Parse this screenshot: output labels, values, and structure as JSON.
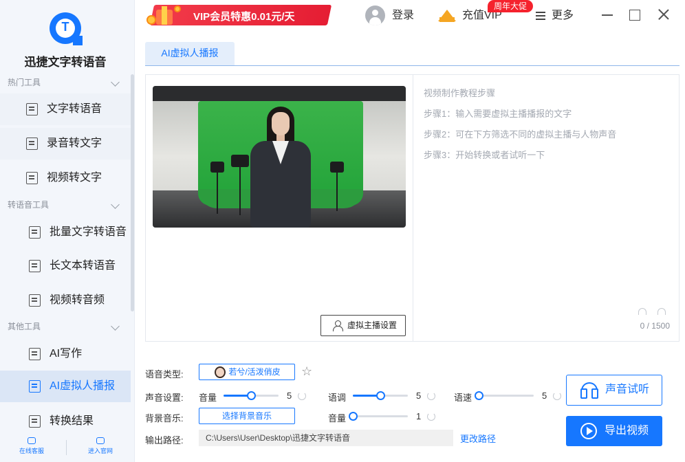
{
  "app": {
    "name": "迅捷文字转语音",
    "logo_letter": "T"
  },
  "sidebar": {
    "sections": [
      {
        "label": "热门工具",
        "items": [
          {
            "label": "文字转语音"
          },
          {
            "label": "录音转文字"
          },
          {
            "label": "视频转文字"
          }
        ]
      },
      {
        "label": "转语音工具",
        "items": [
          {
            "label": "批量文字转语音"
          },
          {
            "label": "长文本转语音"
          },
          {
            "label": "视频转音频"
          }
        ]
      },
      {
        "label": "其他工具",
        "items": [
          {
            "label": "AI写作"
          },
          {
            "label": "AI虚拟人播报",
            "active": true
          },
          {
            "label": "转换结果"
          }
        ]
      }
    ],
    "bottom": {
      "support": "在线客服",
      "website": "进入官网"
    }
  },
  "topbar": {
    "vip_banner": "VIP会员特惠0.01元/天",
    "login": "登录",
    "recharge_vip": "充值VIP",
    "promo_badge": "周年大促",
    "more": "更多"
  },
  "tabs": [
    {
      "label": "AI虚拟人播报",
      "active": true
    }
  ],
  "editor": {
    "host_settings_label": "虚拟主播设置",
    "steps": [
      "视频制作教程步骤",
      "步骤1：输入需要虚拟主播播报的文字",
      "步骤2：可在下方筛选不同的虚拟主播与人物声音",
      "步骤3：开始转换或者试听一下"
    ],
    "char_count": "0 / 1500"
  },
  "controls": {
    "voice_type_label": "语音类型:",
    "voice_name": "若兮/活泼俏皮",
    "sound_settings_label": "声音设置:",
    "volume_label": "音量",
    "volume_value": "5",
    "volume_fraction": 0.5,
    "tone_label": "语调",
    "tone_value": "5",
    "tone_fraction": 0.5,
    "speed_label": "语速",
    "speed_value": "5",
    "speed_fraction": 0.0,
    "bg_music_label": "背景音乐:",
    "bg_music_button": "选择背景音乐",
    "bg_volume_label": "音量",
    "bg_volume_value": "1",
    "bg_volume_fraction": 0.0,
    "output_path_label": "输出路径:",
    "output_path": "C:\\Users\\User\\Desktop\\迅捷文字转语音",
    "change_path": "更改路径"
  },
  "actions": {
    "listen": "声音试听",
    "export": "导出视频"
  },
  "colors": {
    "accent": "#1677ff",
    "active_bg": "#dbe6f6",
    "banner_red": "#e51d33",
    "badge_red": "#f5222d"
  }
}
